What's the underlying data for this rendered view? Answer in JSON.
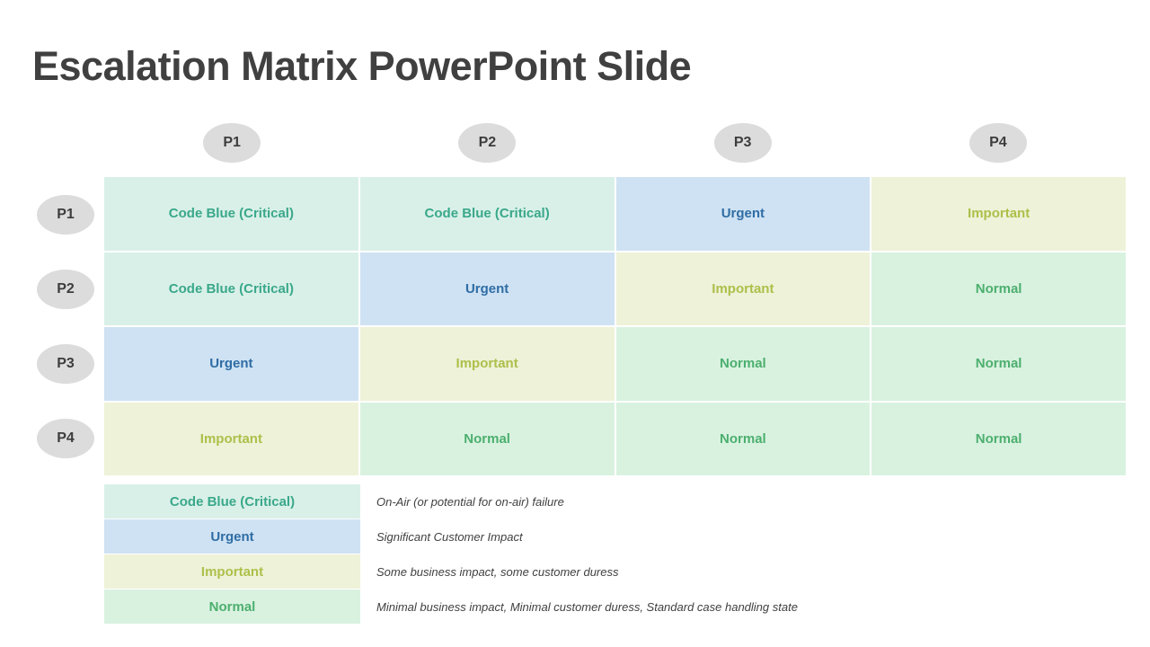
{
  "title": "Escalation Matrix PowerPoint Slide",
  "colors": {
    "title_text": "#404040",
    "pill_bg": "#dcdcdc",
    "pill_text": "#3d3d3d",
    "code_blue_bg": "#d9f0e8",
    "code_blue_text": "#3aa88a",
    "urgent_bg": "#cfe2f3",
    "urgent_text": "#2f6da5",
    "important_bg": "#eef2d8",
    "important_text": "#adbf4a",
    "normal_bg": "#d9f2e0",
    "normal_text": "#4caf6e"
  },
  "matrix": {
    "column_headers": [
      "P1",
      "P2",
      "P3",
      "P4"
    ],
    "row_headers": [
      "P1",
      "P2",
      "P3",
      "P4"
    ],
    "rows": [
      [
        {
          "label": "Code Blue (Critical)",
          "level": "code_blue"
        },
        {
          "label": "Code Blue (Critical)",
          "level": "code_blue"
        },
        {
          "label": "Urgent",
          "level": "urgent"
        },
        {
          "label": "Important",
          "level": "important"
        }
      ],
      [
        {
          "label": "Code Blue (Critical)",
          "level": "code_blue"
        },
        {
          "label": "Urgent",
          "level": "urgent"
        },
        {
          "label": "Important",
          "level": "important"
        },
        {
          "label": "Normal",
          "level": "normal"
        }
      ],
      [
        {
          "label": "Urgent",
          "level": "urgent"
        },
        {
          "label": "Important",
          "level": "important"
        },
        {
          "label": "Normal",
          "level": "normal"
        },
        {
          "label": "Normal",
          "level": "normal"
        }
      ],
      [
        {
          "label": "Important",
          "level": "important"
        },
        {
          "label": "Normal",
          "level": "normal"
        },
        {
          "label": "Normal",
          "level": "normal"
        },
        {
          "label": "Normal",
          "level": "normal"
        }
      ]
    ]
  },
  "legend": [
    {
      "label": "Code Blue (Critical)",
      "level": "code_blue",
      "description": "On-Air (or potential for on-air) failure"
    },
    {
      "label": "Urgent",
      "level": "urgent",
      "description": "Significant Customer Impact"
    },
    {
      "label": "Important",
      "level": "important",
      "description": "Some business impact, some customer duress"
    },
    {
      "label": "Normal",
      "level": "normal",
      "description": "Minimal business impact, Minimal customer duress, Standard case handling state"
    }
  ]
}
